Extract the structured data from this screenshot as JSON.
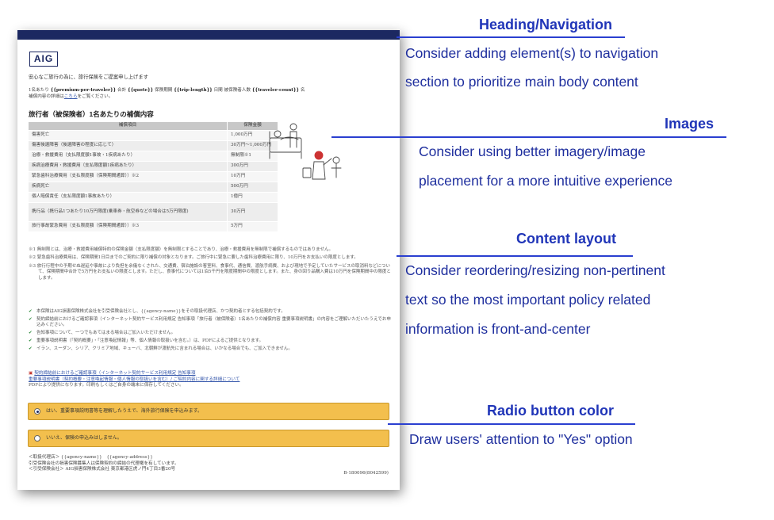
{
  "doc": {
    "logo": "AIG",
    "greeting": "安心なご旅行の為に、旅行保険をご提案申し上げます",
    "quote_prefix": "1名あたり",
    "premium_var": "{{premium-per-traveler}}",
    "quote_total": "合計",
    "quote_var": "{{quote}}",
    "quote_period": "保険期間",
    "trip_var": "{{trip-length}}",
    "quote_days": "日間 被保険者人数",
    "count_var": "{{traveler-count}}",
    "quote_suffix": "名",
    "detail_prefix": "補償内容の詳細は",
    "detail_link": "こちら",
    "detail_suffix": "をご覧ください。",
    "section_title": "旅行者（被保険者）1名あたりの補償内容",
    "table": {
      "headers": [
        "補償項目",
        "保険金額"
      ],
      "rows": [
        {
          "item": "傷害死亡",
          "amount": "1,000万円"
        },
        {
          "item": "傷害後遺障害（後遺障害の程度に応じて）",
          "amount": "30万円～1,000万円"
        },
        {
          "item": "治療・救援費用（支払限度額1事故・1疾病あたり）",
          "amount": "無制限※1"
        },
        {
          "item": "疾病治療費用・救援費用（支払限度額1疾病あたり）",
          "amount": "300万円"
        },
        {
          "item": "緊急歯科治療費用（支払限度額（保険期間通算））※2",
          "amount": "10万円"
        },
        {
          "item": "疾病死亡",
          "amount": "500万円"
        },
        {
          "item": "個人賠償責任（支払限度額1事故あたり）",
          "amount": "1億円"
        },
        {
          "item": "携行品（携行品1つあたり10万円限度(乗車券・航空券などの場合は5万円限度)",
          "amount": "30万円"
        },
        {
          "item": "旅行事故緊急費用（支払限度額（保険期間通算））※3",
          "amount": "5万円"
        }
      ]
    },
    "notes": [
      "※1 無制限とは、治療・救援費用補償特約の保険金額（支払限度額）を無制限とすることであり、治療・救援費用を無制限で補償するものではありません。",
      "※2 緊急歯科治療費用は、保険期間1日目までのご契約に限り補償の対象となります。ご旅行中に緊急に要した歯科治療費用に限り、10万円をお支払いの限度とします。",
      "※3 旅行行程中の予期せぬ遅延や事故により負担を余儀なくされた、交通費、宿泊施設の客室料、食事代、通信費、渡航手続費、および現地で予定していたサービスの取消料などについて、保険期間中合計で5万円をお支払いの限度とします。ただし、食事代については1泊5千円を限度期間中の限度とします。また、身の回り品購入費は10万円を保険期間中の限度とします。"
    ],
    "checks": [
      "本保険はAIG損害保険株式会社を引受保険会社とし、{{agency-name}}をその取扱代理店、かつ契約者とする包括契約です。",
      "契約締結前におけるご確認事項（インターネット契約サービス利用規定 告知事項「旅行者（被保険者）1名あたりの補償内容 重要事項説明書」の内容をご理解いただいたうえでお申込みください。",
      "告知事項について、一つでもあてはまる場合はご加入いただけません。",
      "重要事項説明書（「契約概要」・「注意喚起情報」等、個人情報の取扱いを含む。）は、PDFによるご提供となります。",
      "イラン、スーダン、シリア、クリミア地域、キューバ、北朝鮮が渡航先に含まれる場合は、いかなる場合でも、ご加入できません。"
    ],
    "pdf_link_1": "契約締結前におけるご確認事項（インターネット契約サービス利用規定 告知事項",
    "pdf_link_2": "重要事項説明書（契約概要・注意喚起情報・個人情報の取扱いを含む）/ ご契約内容に関する詳細について",
    "pdf_text": "PDFにより提供になります。印刷もしくはご自身の端末に保存してください。",
    "radio_yes": "はい、重要事項説明書等を理解したうえで、海外旅行保険を申込みます。",
    "radio_no": "いいえ、保険の申込みはしません。",
    "agency_line1": "＜取扱代理店＞ {{agency-name}}　{{agency-address}}",
    "agency_line2": "引受保険会社の損害保険募集人は保険契約の締結の代理権を有しています。",
    "agency_line3": "＜引受保険会社＞ AIG損害保険株式会社 東京都港区虎ノ門4丁目3番20号",
    "doc_code": "B-180096(8042599)"
  },
  "annotations": [
    {
      "title": "Heading/Navigation",
      "lines": [
        "Consider adding element(s) to navigation",
        "section to prioritize main body content"
      ]
    },
    {
      "title": "Images",
      "lines": [
        "Consider using better imagery/image",
        "placement for a more intuitive experience"
      ]
    },
    {
      "title": "Content layout",
      "lines": [
        "Consider reordering/resizing non-pertinent",
        "text so the most important policy related",
        "information is front-and-center"
      ]
    },
    {
      "title": "Radio button color",
      "lines": [
        "Draw users' attention to \"Yes\" option"
      ]
    }
  ],
  "colors": {
    "navy": "#1c2861",
    "accent_blue": "#2035b8",
    "radio_fill": "#f3bf4d"
  }
}
